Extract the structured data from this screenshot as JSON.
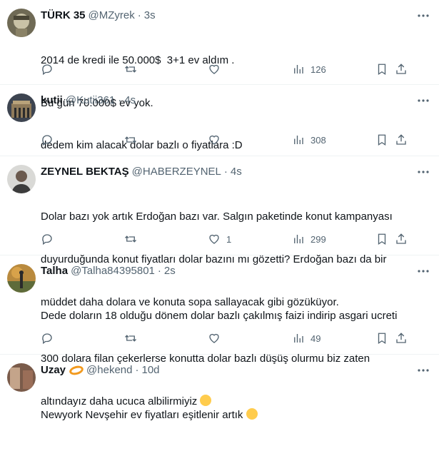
{
  "tweets": [
    {
      "name": "TÜRK 35",
      "handle": "@MZyrek",
      "time": "3s",
      "lines": [
        "2014 de kredi ile 50.000$  3+1 ev aldım .",
        "Bu gün 70.000$ ev yok."
      ],
      "replies": "",
      "retweets": "",
      "likes": "",
      "views": "126"
    },
    {
      "name": "kutii",
      "handle": "@Kutii361",
      "time": "4s",
      "lines": [
        "dedem kim alacak dolar bazlı o fiyatlara :D"
      ],
      "replies": "",
      "retweets": "",
      "likes": "",
      "views": "308"
    },
    {
      "name": "ZEYNEL BEKTAŞ",
      "handle": "@HABERZEYNEL",
      "time": "4s",
      "lines": [
        "Dolar bazı yok artık Erdoğan bazı var. Salgın paketinde konut kampanyası",
        "duyurduğunda konut fiyatları dolar bazını mı gözetti? Erdoğan bazı da bir",
        "müddet daha dolara ve konuta sopa sallayacak gibi gözüküyor."
      ],
      "replies": "",
      "retweets": "",
      "likes": "1",
      "views": "299"
    },
    {
      "name": "Talha",
      "handle": "@Talha84395801",
      "time": "2s",
      "lines": [
        "Dede doların 18 olduğu dönem dolar bazlı çakılmış faizi indirip asgari ucreti",
        "300 dolara filan çekerlerse konutta dolar bazlı düşüş olurmu biz zaten",
        "altındayız daha ucuca albilirmiyiz"
      ],
      "emoji": "thinking-face-emoji",
      "replies": "",
      "retweets": "",
      "likes": "",
      "views": "49"
    },
    {
      "name": "Uzay",
      "handle": "@hekend",
      "time": "10d",
      "lines": [
        "Newyork Nevşehir ev fiyatları eşitlenir artık"
      ],
      "emoji": "grinning-face-emoji"
    }
  ],
  "icons": {
    "more": "more-icon",
    "reply": "reply-icon",
    "retweet": "retweet-icon",
    "like": "heart-icon",
    "views": "views-icon",
    "bookmark": "bookmark-icon",
    "share": "share-icon"
  },
  "colors": {
    "text": "#0f1419",
    "secondary": "#536471",
    "border": "#eff3f4"
  }
}
